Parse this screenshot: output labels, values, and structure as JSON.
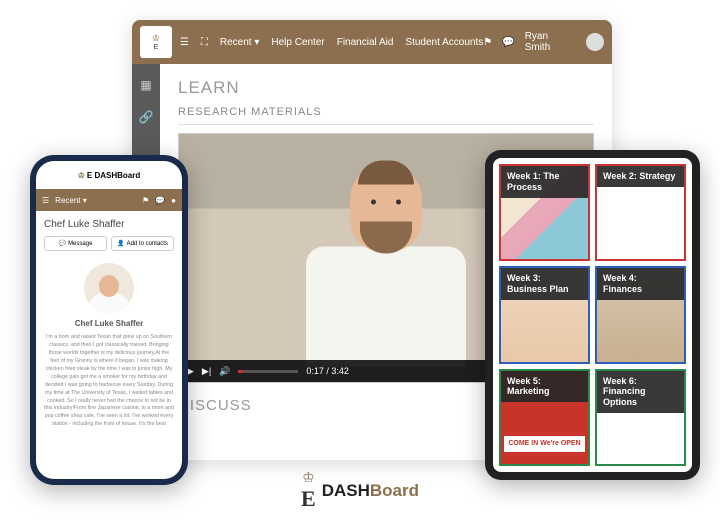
{
  "brand": {
    "dash": "DASH",
    "board": "Board",
    "e": "E"
  },
  "desktop": {
    "nav": {
      "recent": "Recent ▾",
      "help": "Help Center",
      "financial": "Financial Aid",
      "accounts": "Student Accounts"
    },
    "user": "Ryan Smith",
    "learn": "LEARN",
    "research": "RESEARCH MATERIALS",
    "discuss": "DISCUSS",
    "video_time": "0:17 / 3:42"
  },
  "phone": {
    "recent": "Recent ▾",
    "name": "Chef Luke Shaffer",
    "msg": "Message",
    "add": "Add to contacts",
    "avatar_name": "Chef Luke Shaffer",
    "bio": "I'm a born and raised Texan that grew up on Southern classics, and then I got classically trained. Bringing those worlds together is my delicious journey.At the feet of my Granny is where it began. I was making chicken fried steak by the time I was in junior high. My college pals got me a smoker for my birthday and decided I was going to barbecue every Sunday. During my time at The University of Texas, I waited tables and cooked. So I really never had the chance to not be in this industry!From fine Japanese cuisine, to a mom and pop coffee shop cafe, I've seen a lot. I've worked every station - including the front of house. It's the best"
  },
  "tablet": {
    "w1": "Week 1: The Process",
    "w2": "Week 2: Strategy",
    "w3": "Week 3: Business Plan",
    "w4": "Week 4: Finances",
    "w5": "Week 5: Marketing",
    "w6": "Week 6: Financing Options",
    "open_sign": "COME IN\nWe're\nOPEN"
  }
}
